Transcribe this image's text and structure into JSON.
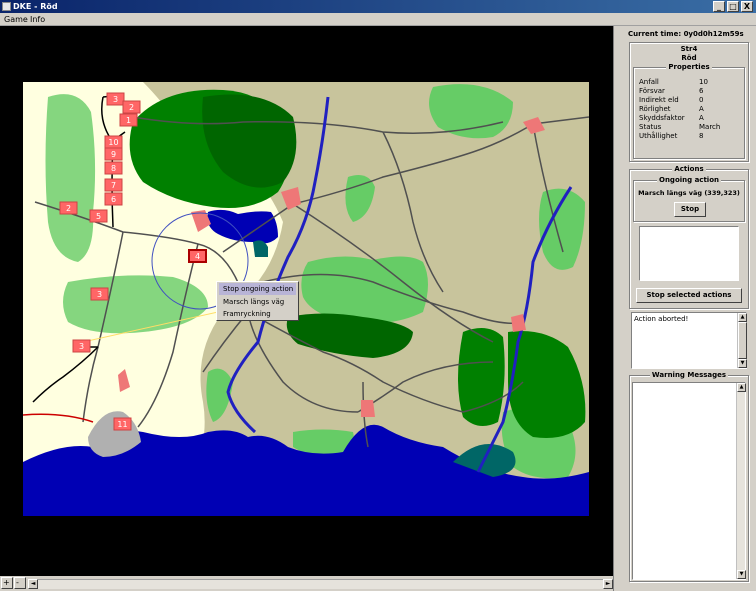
{
  "window": {
    "title": "DKE - Röd",
    "minimize": "_",
    "maximize": "□",
    "close": "X"
  },
  "menu": {
    "items": [
      "Game",
      "Info"
    ]
  },
  "map": {
    "unit_labels": [
      "3",
      "2",
      "1",
      "10",
      "9",
      "8",
      "7",
      "6",
      "5",
      "2",
      "4",
      "3",
      "3",
      "11"
    ],
    "context_menu": {
      "items": [
        "Stop ongoing action",
        "Marsch längs väg",
        "Framryckning"
      ],
      "selected_index": 0
    }
  },
  "zoom": {
    "zoom_in": "+",
    "zoom_out": "-"
  },
  "panel": {
    "current_time_label": "Current time: 0y0d0h12m59s",
    "unit": {
      "name": "Str4",
      "side": "Röd"
    },
    "properties": {
      "title": "Properties",
      "rows": [
        {
          "key": "Anfall",
          "value": "10"
        },
        {
          "key": "Försvar",
          "value": "6"
        },
        {
          "key": "Indirekt eld",
          "value": "0"
        },
        {
          "key": "Rörlighet",
          "value": "A"
        },
        {
          "key": "Skyddsfaktor",
          "value": "A"
        },
        {
          "key": "Status",
          "value": "March"
        },
        {
          "key": "Uthållighet",
          "value": "8"
        }
      ]
    },
    "actions": {
      "title": "Actions",
      "ongoing_title": "Ongoing action",
      "ongoing_text": "Marsch längs väg (339,323)",
      "stop_label": "Stop",
      "stop_selected_label": "Stop selected actions"
    },
    "log": {
      "text": "Action aborted!"
    },
    "warnings": {
      "title": "Warning Messages"
    }
  },
  "colors": {
    "titlebar": "#0a246a",
    "map_background": "#c8c49c",
    "fog": "#ffffe0",
    "forest_light": "#66cc66",
    "forest_dark": "#006600",
    "water": "#0000b4",
    "road": "#505050",
    "river": "#2020c0",
    "unit": "#ff6666",
    "town": "#ee7777"
  }
}
